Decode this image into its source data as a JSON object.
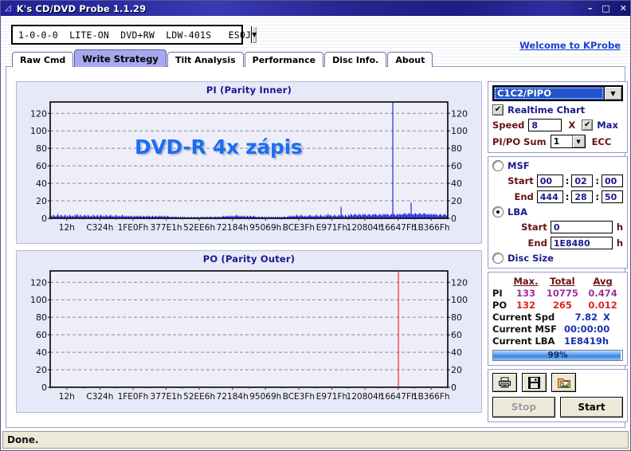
{
  "window": {
    "title": "K's CD/DVD Probe 1.1.29",
    "icon": "disc-icon",
    "minimize": "–",
    "maximize": "□",
    "close": "✕"
  },
  "header": {
    "drive": "1-0-0-0  LITE-ON  DVD+RW  LDW-401S   ES0J",
    "welcome_link": "Welcome to KProbe"
  },
  "tabs": [
    {
      "label": "Raw Cmd",
      "active": false
    },
    {
      "label": "Write Strategy",
      "active": true
    },
    {
      "label": "Tilt Analysis",
      "active": false
    },
    {
      "label": "Performance",
      "active": false
    },
    {
      "label": "Disc Info.",
      "active": false
    },
    {
      "label": "About",
      "active": false
    }
  ],
  "controls": {
    "mode_selected": "C1C2/PIPO",
    "realtime_chart_label": "Realtime Chart",
    "realtime_chart_checked": "✔",
    "speed_label": "Speed",
    "speed_value": "8",
    "speed_unit": "X",
    "max_label": "Max",
    "max_checked": "✔",
    "sum_label": "PI/PO Sum",
    "sum_value": "1",
    "ecc_label": "ECC",
    "msf_label": "MSF",
    "msf_selected": false,
    "msf_start_label": "Start",
    "msf_start": [
      "00",
      "02",
      "00"
    ],
    "msf_end_label": "End",
    "msf_end": [
      "444",
      "28",
      "50"
    ],
    "lba_label": "LBA",
    "lba_selected": true,
    "lba_start_label": "Start",
    "lba_start": "0",
    "lba_end_label": "End",
    "lba_end": "1E8480",
    "hex_suffix": "h",
    "disc_size_label": "Disc Size",
    "disc_size_selected": false
  },
  "stats": {
    "headers": [
      "Max.",
      "Total",
      "Avg"
    ],
    "rows": [
      {
        "name": "PI",
        "max": "133",
        "total": "10775",
        "avg": "0.474"
      },
      {
        "name": "PO",
        "max": "132",
        "total": "265",
        "avg": "0.012"
      }
    ],
    "current_spd_label": "Current Spd",
    "current_spd": "7.82",
    "current_spd_unit": "X",
    "current_msf_label": "Current MSF",
    "current_msf": "00:00:00",
    "current_lba_label": "Current LBA",
    "current_lba": "1E8419h",
    "progress_text": "99%",
    "progress_percent": 99
  },
  "actions": {
    "print_icon": "printer-icon",
    "save_icon": "floppy-save-icon",
    "export_icon": "image-export-icon",
    "stop_label": "Stop",
    "stop_disabled": true,
    "start_label": "Start"
  },
  "statusbar": {
    "text": "Done."
  },
  "colors": {
    "titlebar": "#21219a",
    "tab_active": "#a8a8f0",
    "chart_bg": "#e7e8f8",
    "plot_bg": "#eeeefb",
    "pi_trace": "#1414d8",
    "po_trace": "#e02020",
    "watermark": "#1a6ef5",
    "link": "#1f3fd0",
    "pi_stat": "#a0309a",
    "po_stat": "#e02020"
  },
  "chart_data": [
    {
      "type": "line",
      "id": "pi",
      "title": "PI (Parity Inner)",
      "xlabel": "",
      "ylabel": "",
      "ylim": [
        0,
        133
      ],
      "yticks": [
        0,
        20,
        40,
        60,
        80,
        100,
        120
      ],
      "grid": true,
      "trace_color": "#1414d8",
      "watermark": "DVD-R 4x zápis",
      "xtick_labels": [
        "12h",
        "C324h",
        "1FE0Fh",
        "377E1h",
        "52EE6h",
        "72184h",
        "95069h",
        "BCE3Fh",
        "E971Fh",
        "120804h",
        "16647Fh",
        "1B366Fh"
      ],
      "summary": {
        "max": 133,
        "total": 10775,
        "avg": 0.474
      },
      "note": "Dense low-level noise 1-6 across disc; isolated full-height spike to 133 at ~88% of span; secondary spikes ~13 at 74% and ~18 at 92%.",
      "values": [
        2,
        3,
        2,
        4,
        3,
        2,
        3,
        5,
        3,
        2,
        4,
        3,
        2,
        3,
        4,
        2,
        3,
        2,
        4,
        3,
        2,
        3,
        2,
        4,
        3,
        5,
        3,
        2,
        4,
        3,
        2,
        3,
        4,
        3,
        2,
        4,
        3,
        2,
        3,
        2,
        4,
        3,
        2,
        3,
        4,
        2,
        3,
        4,
        3,
        2,
        3,
        2,
        4,
        3,
        2,
        3,
        4,
        3,
        2,
        3,
        2,
        4,
        3,
        2,
        3,
        2,
        3,
        4,
        2,
        3,
        2,
        3,
        2,
        3,
        2,
        3,
        2,
        2,
        3,
        2,
        3,
        2,
        3,
        2,
        3,
        2,
        2,
        3,
        2,
        2,
        3,
        2,
        3,
        2,
        2,
        3,
        2,
        2,
        3,
        2,
        2,
        3,
        2,
        3,
        2,
        2,
        3,
        2,
        2,
        3,
        2,
        2,
        1,
        2,
        2,
        1,
        2,
        2,
        1,
        2,
        1,
        2,
        1,
        2,
        1,
        2,
        1,
        1,
        2,
        1,
        1,
        2,
        1,
        1,
        2,
        1,
        1,
        2,
        1,
        1,
        2,
        1,
        2,
        1,
        2,
        1,
        2,
        1,
        2,
        2,
        1,
        2,
        1,
        2,
        2,
        1,
        2,
        2,
        1,
        2,
        2,
        3,
        2,
        2,
        3,
        2,
        3,
        2,
        3,
        2,
        3,
        2,
        3,
        4,
        3,
        2,
        3,
        2,
        3,
        2,
        3,
        2,
        2,
        3,
        2,
        2,
        3,
        2,
        2,
        3,
        2,
        2,
        1,
        2,
        2,
        1,
        2,
        2,
        1,
        2,
        1,
        2,
        1,
        2,
        1,
        2,
        1,
        2,
        1,
        2,
        1,
        2,
        1,
        2,
        1,
        2,
        1,
        2,
        2,
        1,
        2,
        2,
        3,
        2,
        3,
        2,
        3,
        2,
        3,
        4,
        3,
        2,
        3,
        4,
        3,
        2,
        3,
        2,
        3,
        2,
        3,
        4,
        3,
        2,
        3,
        2,
        3,
        4,
        3,
        2,
        3,
        4,
        3,
        2,
        3,
        2,
        4,
        3,
        5,
        3,
        4,
        3,
        2,
        3,
        4,
        3,
        2,
        3,
        4,
        3,
        13,
        4,
        3,
        2,
        4,
        3,
        2,
        4,
        3,
        5,
        4,
        3,
        4,
        5,
        4,
        3,
        4,
        5,
        4,
        3,
        5,
        4,
        5,
        4,
        3,
        4,
        5,
        4,
        3,
        4,
        5,
        4,
        5,
        4,
        3,
        4,
        5,
        4,
        3,
        5,
        4,
        5,
        4,
        5,
        4,
        3,
        4,
        5,
        133,
        5,
        4,
        3,
        5,
        4,
        5,
        4,
        5,
        4,
        5,
        6,
        5,
        4,
        5,
        6,
        5,
        18,
        5,
        4,
        5,
        6,
        5,
        4,
        5,
        6,
        5,
        4,
        5,
        6,
        5,
        4,
        5,
        4,
        5,
        4,
        5,
        4,
        5,
        4,
        5,
        4,
        3,
        4,
        5,
        4,
        3,
        4,
        5,
        4,
        3,
        4
      ]
    },
    {
      "type": "line",
      "id": "po",
      "title": "PO (Parity Outer)",
      "xlabel": "",
      "ylabel": "",
      "ylim": [
        0,
        133
      ],
      "yticks": [
        0,
        20,
        40,
        60,
        80,
        100,
        120
      ],
      "grid": true,
      "trace_color": "#e02020",
      "watermark": "",
      "xtick_labels": [
        "12h",
        "C324h",
        "1FE0Fh",
        "377E1h",
        "52EE6h",
        "72184h",
        "95069h",
        "BCE3Fh",
        "E971Fh",
        "120804h",
        "16647Fh",
        "1B366Fh"
      ],
      "summary": {
        "max": 132,
        "total": 265,
        "avg": 0.012
      },
      "note": "Essentially flat at 0 with rare 1-unit ticks; one full-height spike to 132 at ~88% of span (same location as PI spike).",
      "values": [
        0,
        0,
        1,
        0,
        0,
        0,
        0,
        0,
        0,
        0,
        0,
        0,
        0,
        0,
        0,
        0,
        0,
        0,
        0,
        0,
        0,
        1,
        0,
        0,
        0,
        0,
        0,
        0,
        0,
        0,
        0,
        0,
        0,
        0,
        0,
        0,
        0,
        0,
        0,
        0,
        0,
        0,
        0,
        0,
        0,
        0,
        0,
        0,
        0,
        0,
        0,
        0,
        0,
        0,
        0,
        0,
        0,
        0,
        0,
        0,
        0,
        0,
        0,
        0,
        0,
        0,
        0,
        0,
        0,
        0,
        0,
        0,
        0,
        0,
        0,
        0,
        0,
        0,
        0,
        0,
        0,
        0,
        0,
        0,
        0,
        0,
        0,
        0,
        0,
        0,
        0,
        0,
        0,
        0,
        0,
        0,
        0,
        0,
        0,
        0,
        0,
        0,
        0,
        0,
        0,
        0,
        0,
        0,
        0,
        0,
        1,
        0,
        0,
        0,
        0,
        0,
        0,
        0,
        0,
        0,
        0,
        0,
        0,
        0,
        0,
        0,
        0,
        0,
        0,
        0,
        0,
        0,
        0,
        0,
        0,
        0,
        0,
        0,
        0,
        0,
        0,
        0,
        0,
        0,
        0,
        0,
        0,
        0,
        0,
        0,
        0,
        0,
        0,
        0,
        0,
        0,
        0,
        0,
        0,
        0,
        0,
        0,
        0,
        0,
        0,
        0,
        0,
        0,
        0,
        0,
        0,
        0,
        0,
        0,
        0,
        0,
        0,
        0,
        0,
        0,
        0,
        0,
        0,
        0,
        0,
        1,
        0,
        0,
        0,
        0,
        0,
        0,
        0,
        0,
        0,
        0,
        0,
        0,
        0,
        0,
        0,
        0,
        0,
        0,
        0,
        0,
        0,
        0,
        0,
        0,
        0,
        0,
        0,
        0,
        0,
        0,
        0,
        0,
        0,
        0,
        0,
        0,
        0,
        0,
        0,
        0,
        0,
        0,
        0,
        0,
        0,
        0,
        0,
        0,
        0,
        0,
        0,
        0,
        0,
        0,
        0,
        0,
        0,
        0,
        0,
        0,
        0,
        0,
        0,
        0,
        0,
        0,
        0,
        0,
        0,
        0,
        0,
        0,
        0,
        0,
        0,
        0,
        0,
        0,
        0,
        0,
        0,
        0,
        0,
        0,
        0,
        0,
        0,
        0,
        0,
        0,
        0,
        0,
        0,
        0,
        0,
        0,
        0,
        0,
        0,
        1,
        0,
        0,
        0,
        0,
        0,
        0,
        0,
        0,
        0,
        0,
        0,
        0,
        0,
        0,
        0,
        0,
        0,
        0,
        0,
        0,
        0,
        0,
        0,
        0,
        0,
        0,
        0,
        0,
        0,
        0,
        0,
        0,
        0,
        0,
        0,
        0,
        0,
        0,
        0,
        0,
        0,
        0,
        0,
        0,
        0,
        0,
        0,
        0,
        0,
        0,
        0,
        0,
        0,
        0,
        0,
        0,
        0,
        0,
        0,
        0,
        0,
        0,
        0,
        0,
        0,
        0,
        0,
        132,
        0,
        0,
        0,
        0,
        0,
        0,
        0,
        0,
        0,
        0,
        0,
        0,
        0,
        0,
        0,
        0,
        0,
        0,
        0,
        0,
        0,
        0,
        0,
        0,
        0,
        0,
        0,
        0,
        1,
        0,
        0,
        0,
        0,
        0,
        0,
        0,
        0,
        0,
        0,
        0,
        0,
        0,
        0,
        0,
        0,
        0,
        0,
        0,
        0,
        0
      ]
    }
  ]
}
